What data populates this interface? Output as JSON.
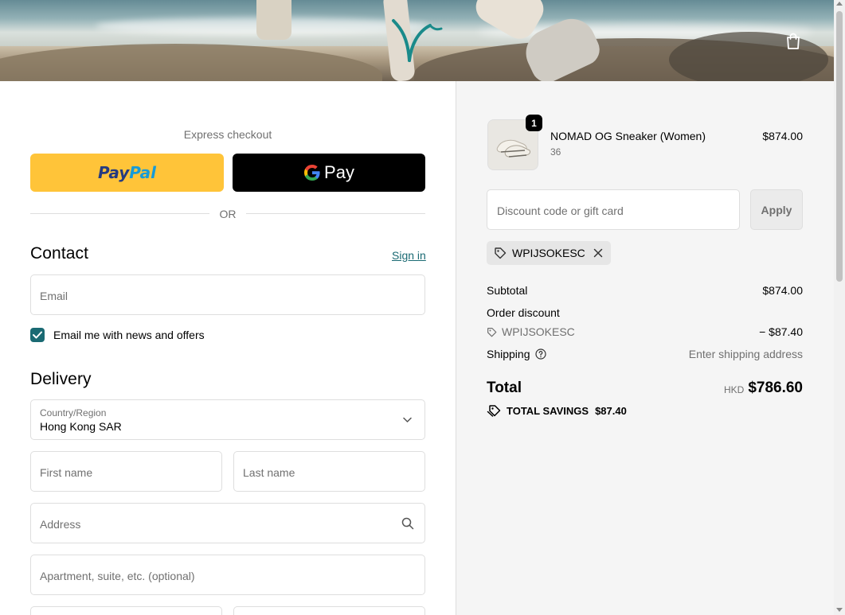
{
  "header": {
    "cart_icon": "shopping-bag-icon"
  },
  "express": {
    "label": "Express checkout",
    "paypal_part1": "Pay",
    "paypal_part2": "Pal",
    "gpay_label": "Pay",
    "divider": "OR"
  },
  "contact": {
    "title": "Contact",
    "signin": "Sign in",
    "email_placeholder": "Email",
    "newsletter_label": "Email me with news and offers",
    "newsletter_checked": true
  },
  "delivery": {
    "title": "Delivery",
    "country_label": "Country/Region",
    "country_value": "Hong Kong SAR",
    "first_name_placeholder": "First name",
    "last_name_placeholder": "Last name",
    "address_placeholder": "Address",
    "apartment_placeholder": "Apartment, suite, etc. (optional)"
  },
  "summary": {
    "product": {
      "name": "NOMAD OG Sneaker (Women)",
      "variant": "36",
      "price": "$874.00",
      "quantity": "1"
    },
    "discount_placeholder": "Discount code or gift card",
    "apply_label": "Apply",
    "applied_code": "WPIJSOKESC",
    "subtotal_label": "Subtotal",
    "subtotal_value": "$874.00",
    "order_discount_label": "Order discount",
    "order_discount_code": "WPIJSOKESC",
    "order_discount_value": "− $87.40",
    "shipping_label": "Shipping",
    "shipping_value": "Enter shipping address",
    "total_label": "Total",
    "total_currency": "HKD",
    "total_value": "$786.60",
    "savings_label": "TOTAL SAVINGS",
    "savings_value": "$87.40"
  },
  "colors": {
    "accent": "#1a6a73",
    "paypal_yellow": "#ffc439"
  }
}
